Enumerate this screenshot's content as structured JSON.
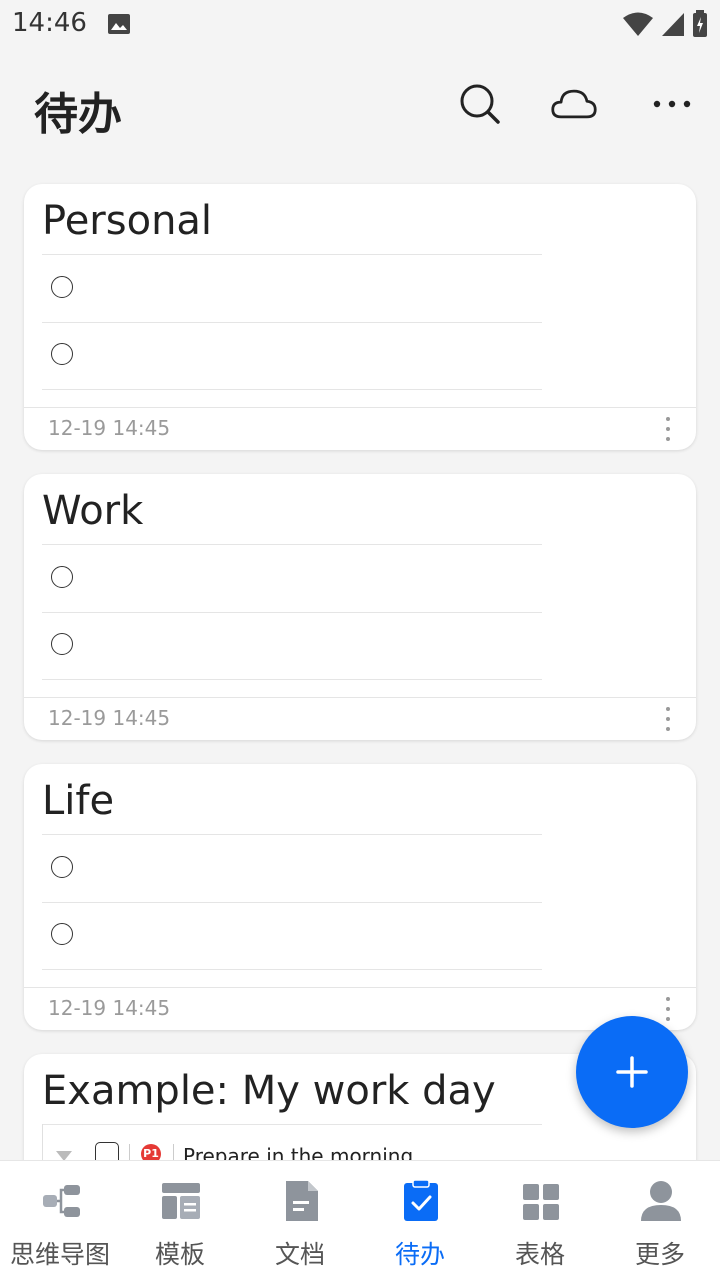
{
  "status_bar": {
    "time": "14:46"
  },
  "app_bar": {
    "title": "待办"
  },
  "lists": [
    {
      "title": "Personal",
      "date": "12-19 14:45"
    },
    {
      "title": "Work",
      "date": "12-19 14:45"
    },
    {
      "title": "Life",
      "date": "12-19 14:45"
    }
  ],
  "example": {
    "title": "Example: My work day",
    "first_item": "Prepare in the morning",
    "priority": "P1"
  },
  "nav": [
    {
      "label": "思维导图"
    },
    {
      "label": "模板"
    },
    {
      "label": "文档"
    },
    {
      "label": "待办"
    },
    {
      "label": "表格"
    },
    {
      "label": "更多"
    }
  ],
  "colors": {
    "accent": "#0a6cf6",
    "priority_red": "#e53935"
  }
}
